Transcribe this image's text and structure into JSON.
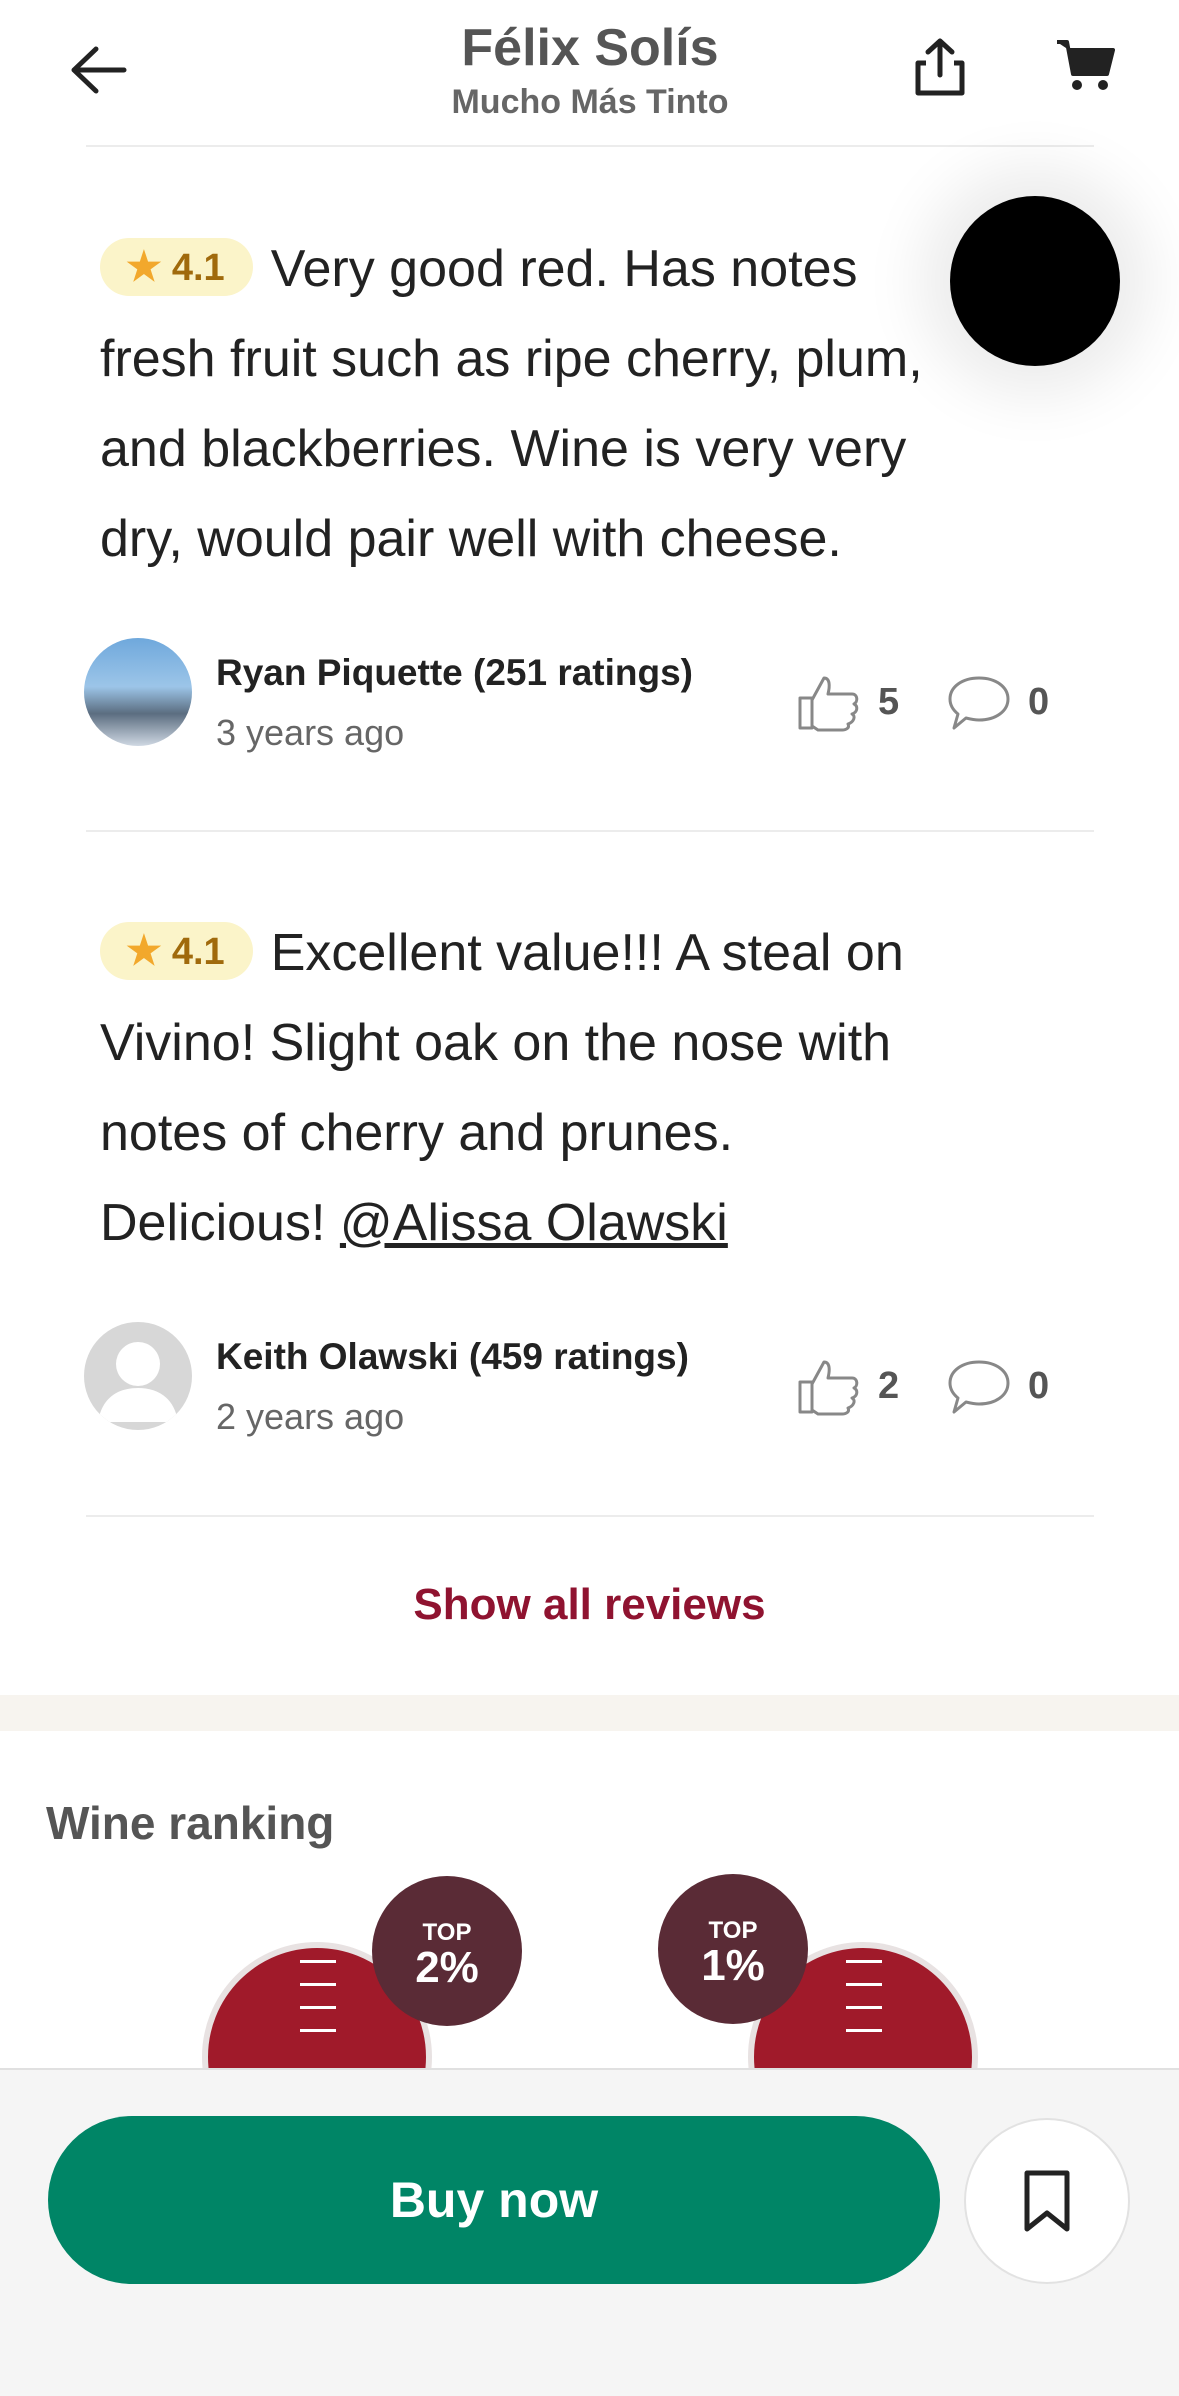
{
  "header": {
    "title": "Félix Solís",
    "subtitle": "Mucho Más Tinto",
    "back_icon": "arrow-left-icon",
    "share_icon": "share-icon",
    "cart_icon": "cart-icon"
  },
  "reviews": [
    {
      "rating": "4.1",
      "text_lines": [
        "Very good red. Has notes",
        "fresh fruit such as ripe cherry, plum,",
        "and blackberries. Wine is very very",
        "dry, would pair well with cheese."
      ],
      "user": "Ryan Piquette (251 ratings)",
      "time": "3 years ago",
      "likes": "5",
      "comments": "0"
    },
    {
      "rating": "4.1",
      "text_lines": [
        "Excellent value!!! A steal on",
        "Vivino!  Slight oak on the nose with",
        "notes of cherry and prunes.",
        "Delicious! "
      ],
      "mention": "@Alissa Olawski",
      "user": "Keith Olawski (459 ratings)",
      "time": "2 years ago",
      "likes": "2",
      "comments": "0"
    }
  ],
  "show_all": "Show all reviews",
  "ranking": {
    "title": "Wine ranking",
    "badges": [
      {
        "label": "TOP",
        "value": "2%"
      },
      {
        "label": "TOP",
        "value": "1%"
      }
    ]
  },
  "actions": {
    "buy_label": "Buy now",
    "save_icon": "bookmark-icon"
  },
  "colors": {
    "accent_green": "#008566",
    "brand_red": "#8f1330",
    "rating_bg": "#fbf4c9",
    "badge_bg": "#5a2b36"
  }
}
